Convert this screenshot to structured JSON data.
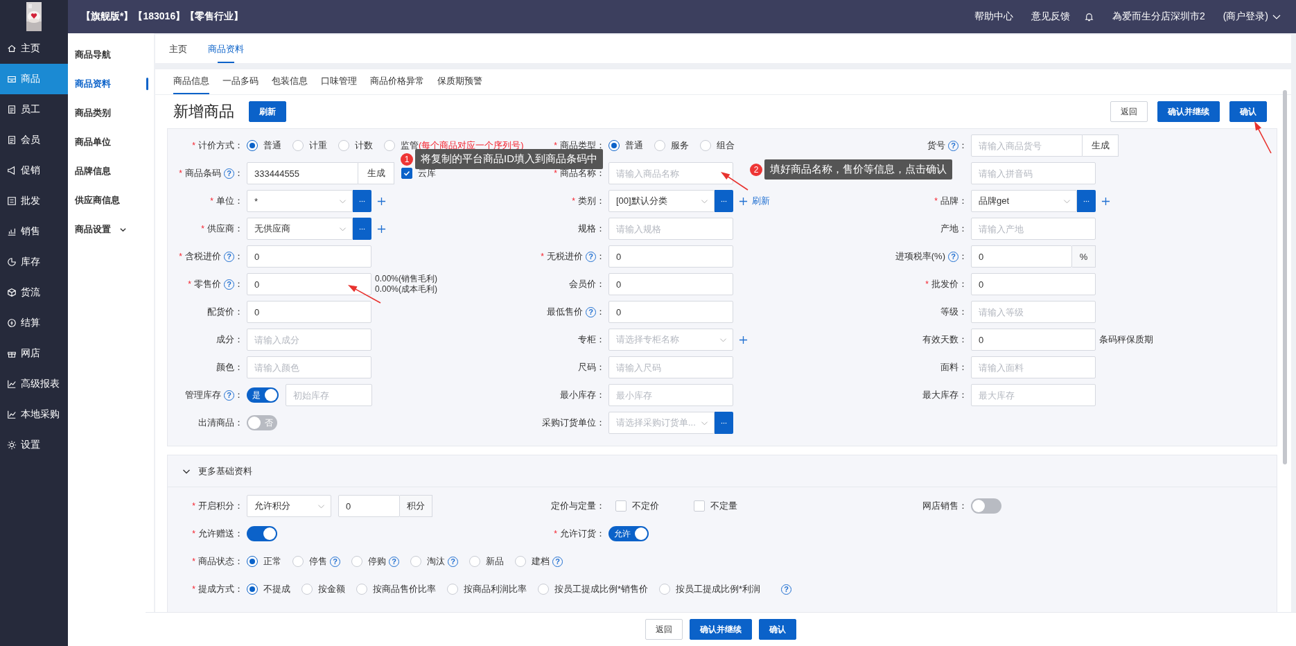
{
  "header": {
    "title": "【旗舰版*】【183016】【零售行业】",
    "links": [
      "帮助中心",
      "意见反馈"
    ],
    "store": "為爱而生分店深圳市2",
    "account": "(商户登录)"
  },
  "sidebar": {
    "items": [
      {
        "label": "主页",
        "selected": false
      },
      {
        "label": "商品",
        "selected": true
      },
      {
        "label": "员工",
        "selected": false
      },
      {
        "label": "会员",
        "selected": false
      },
      {
        "label": "促销",
        "selected": false
      },
      {
        "label": "批发",
        "selected": false
      },
      {
        "label": "销售",
        "selected": false
      },
      {
        "label": "库存",
        "selected": false
      },
      {
        "label": "货流",
        "selected": false
      },
      {
        "label": "结算",
        "selected": false
      },
      {
        "label": "网店",
        "selected": false
      },
      {
        "label": "高级报表",
        "selected": false
      },
      {
        "label": "本地采购",
        "selected": false
      },
      {
        "label": "设置",
        "selected": false
      }
    ]
  },
  "subnav": {
    "items": [
      {
        "label": "商品导航",
        "selected": false,
        "expandable": false
      },
      {
        "label": "商品资料",
        "selected": true,
        "expandable": false
      },
      {
        "label": "商品类别",
        "selected": false,
        "expandable": false
      },
      {
        "label": "商品单位",
        "selected": false,
        "expandable": false
      },
      {
        "label": "品牌信息",
        "selected": false,
        "expandable": false
      },
      {
        "label": "供应商信息",
        "selected": false,
        "expandable": false
      },
      {
        "label": "商品设置",
        "selected": false,
        "expandable": true
      }
    ]
  },
  "page_tabs": [
    {
      "label": "主页",
      "selected": false
    },
    {
      "label": "商品资料",
      "selected": true
    }
  ],
  "section_tabs": [
    {
      "label": "商品信息",
      "selected": true
    },
    {
      "label": "一品多码",
      "selected": false
    },
    {
      "label": "包装信息",
      "selected": false
    },
    {
      "label": "口味管理",
      "selected": false
    },
    {
      "label": "商品价格异常",
      "selected": false
    },
    {
      "label": "保质期预警",
      "selected": false
    }
  ],
  "page": {
    "title": "新增商品",
    "refresh": "刷新",
    "actions": [
      {
        "label": "返回",
        "kind": "default"
      },
      {
        "label": "确认并继续",
        "kind": "primary"
      },
      {
        "label": "确认",
        "kind": "primary"
      }
    ]
  },
  "form": {
    "rows": [
      [
        {
          "required": "*",
          "label": "计价方式：",
          "controls": [
            {
              "kind": "radio",
              "options": [
                {
                  "label": "普通",
                  "selected": true
                },
                {
                  "label": "计重",
                  "selected": false
                },
                {
                  "label": "计数",
                  "selected": false
                },
                {
                  "label": "监管",
                  "selected": false,
                  "note": "(每个商品对应一个序列号)"
                }
              ]
            }
          ]
        },
        {
          "required": "*",
          "label": "商品类型：",
          "controls": [
            {
              "kind": "radio",
              "options": [
                {
                  "label": "普通",
                  "selected": true
                },
                {
                  "label": "服务",
                  "selected": false
                },
                {
                  "label": "组合",
                  "selected": false
                }
              ]
            }
          ]
        },
        {
          "label": "货号",
          "help": "?",
          "colon": "：",
          "controls": [
            {
              "kind": "input",
              "placeholder": "请输入商品货号",
              "addon": "生成"
            }
          ]
        }
      ],
      [
        {
          "required": "*",
          "label": "商品条码",
          "help": "?",
          "colon": "：",
          "controls": [
            {
              "kind": "input",
              "value": "333444555",
              "addon": "生成"
            },
            {
              "kind": "checkbox",
              "label": "云库",
              "checked": true
            }
          ]
        },
        {
          "required": "*",
          "label": "商品名称：",
          "controls": [
            {
              "kind": "input",
              "placeholder": "请输入商品名称"
            }
          ]
        },
        {
          "controls": [
            {
              "kind": "input",
              "placeholder": "请输入拼音码"
            }
          ]
        }
      ],
      [
        {
          "required": "*",
          "label": "单位：",
          "controls": [
            {
              "kind": "select",
              "value": "*"
            },
            {
              "kind": "more"
            },
            {
              "kind": "add"
            }
          ]
        },
        {
          "required": "*",
          "label": "类别：",
          "controls": [
            {
              "kind": "select",
              "value": "[00]默认分类"
            },
            {
              "kind": "more"
            },
            {
              "kind": "add"
            },
            {
              "kind": "link",
              "text": "刷新"
            }
          ]
        },
        {
          "required": "*",
          "label": "品牌：",
          "controls": [
            {
              "kind": "select",
              "value": "品牌get"
            },
            {
              "kind": "more"
            },
            {
              "kind": "add"
            }
          ]
        }
      ],
      [
        {
          "required": "*",
          "label": "供应商：",
          "controls": [
            {
              "kind": "select",
              "value": "无供应商"
            },
            {
              "kind": "more"
            },
            {
              "kind": "add"
            }
          ]
        },
        {
          "label": "规格：",
          "controls": [
            {
              "kind": "input",
              "placeholder": "请输入规格"
            }
          ]
        },
        {
          "label": "产地：",
          "controls": [
            {
              "kind": "input",
              "placeholder": "请输入产地"
            }
          ]
        }
      ],
      [
        {
          "required": "*",
          "label": "含税进价",
          "help": "?",
          "colon": "：",
          "controls": [
            {
              "kind": "input",
              "value": "0"
            }
          ]
        },
        {
          "required": "*",
          "label": "无税进价",
          "help": "?",
          "colon": "：",
          "controls": [
            {
              "kind": "input",
              "value": "0"
            }
          ]
        },
        {
          "label": "进项税率(%)",
          "help": "?",
          "colon": "：",
          "controls": [
            {
              "kind": "input",
              "value": "0",
              "unit": "%"
            }
          ]
        }
      ],
      [
        {
          "required": "*",
          "label": "零售价",
          "help": "?",
          "colon": "：",
          "controls": [
            {
              "kind": "input",
              "value": "0"
            },
            {
              "kind": "notes",
              "lines": [
                "0.00%(销售毛利)",
                "0.00%(成本毛利)"
              ]
            }
          ]
        },
        {
          "label": "会员价：",
          "controls": [
            {
              "kind": "input",
              "value": "0"
            }
          ]
        },
        {
          "required": "*",
          "label": "批发价：",
          "controls": [
            {
              "kind": "input",
              "value": "0"
            }
          ]
        }
      ],
      [
        {
          "label": "配货价：",
          "controls": [
            {
              "kind": "input",
              "value": "0"
            }
          ]
        },
        {
          "label": "最低售价",
          "help": "?",
          "colon": "：",
          "controls": [
            {
              "kind": "input",
              "value": "0"
            }
          ]
        },
        {
          "label": "等级：",
          "controls": [
            {
              "kind": "input",
              "placeholder": "请输入等级"
            }
          ]
        }
      ],
      [
        {
          "label": "成分：",
          "controls": [
            {
              "kind": "input",
              "placeholder": "请输入成分"
            }
          ]
        },
        {
          "label": "专柜：",
          "controls": [
            {
              "kind": "select",
              "placeholder": "请选择专柜名称"
            },
            {
              "kind": "add"
            }
          ]
        },
        {
          "label": "有效天数：",
          "controls": [
            {
              "kind": "input",
              "value": "0"
            },
            {
              "kind": "text",
              "text": "条码秤保质期"
            }
          ]
        }
      ],
      [
        {
          "label": "颜色：",
          "controls": [
            {
              "kind": "input",
              "placeholder": "请输入颜色"
            }
          ]
        },
        {
          "label": "尺码：",
          "controls": [
            {
              "kind": "input",
              "placeholder": "请输入尺码"
            }
          ]
        },
        {
          "label": "面料：",
          "controls": [
            {
              "kind": "input",
              "placeholder": "请输入面料"
            }
          ]
        }
      ],
      [
        {
          "label": "管理库存",
          "help": "?",
          "colon": "：",
          "controls": [
            {
              "kind": "toggle",
              "on": true,
              "text": "是"
            },
            {
              "kind": "input",
              "placeholder": "初始库存"
            }
          ]
        },
        {
          "label": "最小库存：",
          "controls": [
            {
              "kind": "input",
              "placeholder": "最小库存"
            }
          ]
        },
        {
          "label": "最大库存：",
          "controls": [
            {
              "kind": "input",
              "placeholder": "最大库存"
            }
          ]
        }
      ],
      [
        {
          "label": "出清商品：",
          "controls": [
            {
              "kind": "toggle",
              "on": false,
              "text": "否"
            }
          ]
        },
        {
          "label": "采购订货单位：",
          "controls": [
            {
              "kind": "select",
              "placeholder": "请选择采购订货单..."
            },
            {
              "kind": "more"
            }
          ]
        }
      ]
    ]
  },
  "more": {
    "title": "更多基础资料",
    "expanded": true,
    "rows": [
      [
        {
          "required": "*",
          "label": "开启积分：",
          "controls": [
            {
              "kind": "select",
              "value": "允许积分"
            },
            {
              "kind": "input",
              "value": "0",
              "unit": "积分"
            }
          ]
        },
        {
          "label": "定价与定量：",
          "controls": [
            {
              "kind": "checkbox",
              "label": "不定价",
              "checked": false
            },
            {
              "kind": "checkbox",
              "label": "不定量",
              "checked": false
            }
          ]
        },
        {
          "label": "网店销售：",
          "controls": [
            {
              "kind": "toggle",
              "on": false
            }
          ]
        }
      ],
      [
        {
          "required": "*",
          "label": "允许赠送：",
          "controls": [
            {
              "kind": "toggle",
              "on": true
            }
          ]
        },
        {
          "required": "*",
          "label": "允许订货：",
          "controls": [
            {
              "kind": "toggle",
              "on": true,
              "text": "允许"
            }
          ]
        }
      ],
      [
        {
          "required": "*",
          "label": "商品状态：",
          "controls": [
            {
              "kind": "radio",
              "options": [
                {
                  "label": "正常",
                  "selected": true
                },
                {
                  "label": "停售",
                  "selected": false,
                  "help": "?"
                },
                {
                  "label": "停购",
                  "selected": false,
                  "help": "?"
                },
                {
                  "label": "淘汰",
                  "selected": false,
                  "help": "?"
                },
                {
                  "label": "新品",
                  "selected": false
                },
                {
                  "label": "建档",
                  "selected": false,
                  "help": "?"
                }
              ]
            }
          ]
        }
      ],
      [
        {
          "required": "*",
          "label": "提成方式：",
          "controls": [
            {
              "kind": "radio",
              "options": [
                {
                  "label": "不提成",
                  "selected": true
                },
                {
                  "label": "按金额",
                  "selected": false
                },
                {
                  "label": "按商品售价比率",
                  "selected": false
                },
                {
                  "label": "按商品利润比率",
                  "selected": false
                },
                {
                  "label": "按员工提成比例*销售价",
                  "selected": false
                },
                {
                  "label": "按员工提成比例*利润",
                  "selected": false
                }
              ]
            },
            {
              "kind": "help",
              "text": "?"
            }
          ]
        }
      ]
    ]
  },
  "footer": {
    "actions": [
      {
        "label": "返回",
        "kind": "default"
      },
      {
        "label": "确认并继续",
        "kind": "primary"
      },
      {
        "label": "确认",
        "kind": "primary"
      }
    ]
  },
  "annotations": [
    {
      "number": "1",
      "text": "将复制的平台商品ID填入到商品条码中"
    },
    {
      "number": "2",
      "text": "填好商品名称，售价等信息，点击确认"
    }
  ]
}
